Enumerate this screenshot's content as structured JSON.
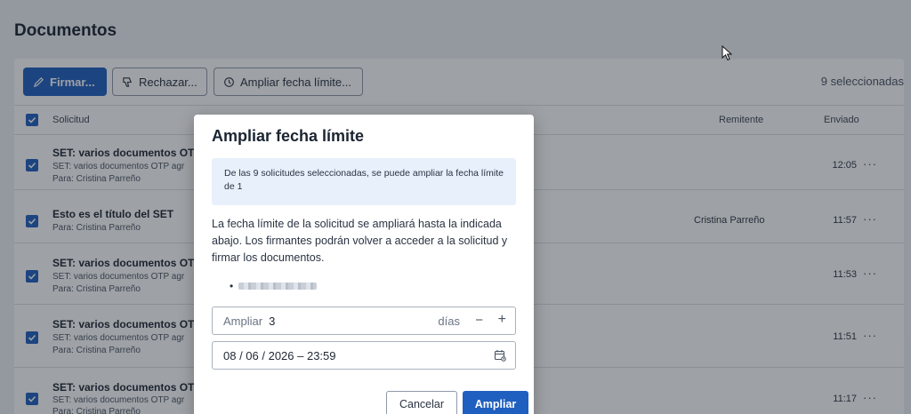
{
  "page": {
    "title": "Documentos"
  },
  "toolbar": {
    "sign_label": "Firmar...",
    "reject_label": "Rechazar...",
    "extend_label": "Ampliar fecha límite...",
    "selected_count": "9 seleccionadas"
  },
  "table": {
    "headers": {
      "request": "Solicitud",
      "sender": "Remitente",
      "sent": "Enviado"
    },
    "rows": [
      {
        "title": "SET: varios documentos OTP",
        "subtitle": "SET: varios documentos OTP agr",
        "to": "Para: Cristina Parreño",
        "sender": "",
        "time": "12:05"
      },
      {
        "title": "Esto es el título del SET",
        "subtitle": "",
        "to": "Para: Cristina Parreño",
        "sender": "Cristina Parreño",
        "time": "11:57"
      },
      {
        "title": "SET: varios documentos OTP",
        "subtitle": "SET: varios documentos OTP agr",
        "to": "Para: Cristina Parreño",
        "sender": "",
        "time": "11:53"
      },
      {
        "title": "SET: varios documentos OTP",
        "subtitle": "SET: varios documentos OTP agr",
        "to": "Para: Cristina Parreño",
        "sender": "",
        "time": "11:51"
      },
      {
        "title": "SET: varios documentos OTP",
        "subtitle": "SET: varios documentos OTP agr",
        "to": "Para: Cristina Parreño",
        "sender": "",
        "time": "11:17"
      }
    ],
    "more_glyph": "···"
  },
  "modal": {
    "title": "Ampliar fecha límite",
    "info": "De las 9 solicitudes seleccionadas, se puede ampliar la fecha límite de 1",
    "description": "La fecha límite de la solicitud se ampliará hasta la indicada abajo. Los firmantes podrán volver a acceder a la solicitud y firmar los documentos.",
    "extend_label": "Ampliar",
    "extend_value": "3",
    "extend_unit": "días",
    "minus": "−",
    "plus": "+",
    "date_value": "08 / 06 / 2026 – 23:59",
    "cancel_label": "Cancelar",
    "apply_label": "Ampliar"
  },
  "colors": {
    "primary": "#1f5fbf",
    "info_bg": "#e7f0fb"
  }
}
